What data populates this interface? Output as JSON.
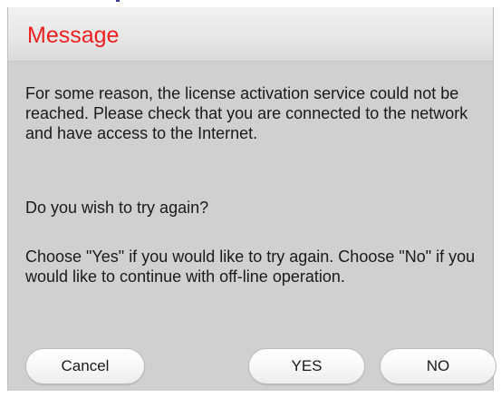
{
  "dialog": {
    "title": "Message",
    "title_color": "#ee2020",
    "paragraphs": [
      "For some reason, the license activation service could not be reached. Please check that you are connected to the network and have access to the Internet.",
      "Do you wish to try again?",
      "Choose \"Yes\" if you would like to try again. Choose \"No\" if you would like to continue with off-line operation."
    ],
    "buttons": {
      "cancel_label": "Cancel",
      "yes_label": "YES",
      "no_label": "NO"
    }
  }
}
